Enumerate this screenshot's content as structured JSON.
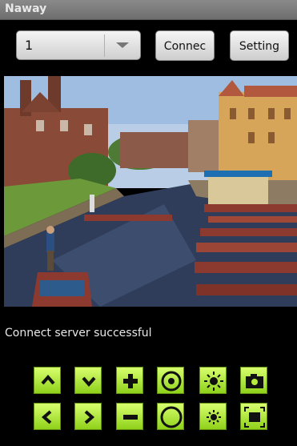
{
  "app": {
    "title": "Naway"
  },
  "toolbar": {
    "channel_value": "1",
    "connect_label": "Connec",
    "setting_label": "Setting"
  },
  "status": {
    "text": "Connect server successful"
  },
  "controls": {
    "row1": [
      "up-arrow-icon",
      "down-arrow-icon",
      "plus-icon",
      "focus-near-icon",
      "brightness-up-icon",
      "camera-icon"
    ],
    "row2": [
      "left-arrow-icon",
      "right-arrow-icon",
      "minus-icon",
      "focus-far-icon",
      "brightness-down-icon",
      "fullscreen-icon"
    ]
  },
  "colors": {
    "button_green_top": "#d8ff6e",
    "button_green_bottom": "#8fd11a"
  }
}
